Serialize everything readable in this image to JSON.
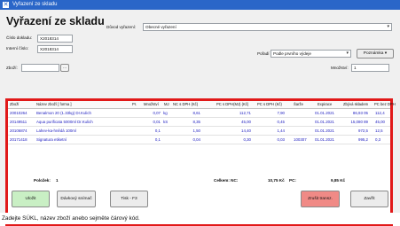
{
  "window": {
    "title": "Vyřazení ze skladu"
  },
  "header": {
    "title": "Vyřazení ze skladu",
    "doc_number_label": "Číslo dokladu:",
    "doc_number_value": "X2018314",
    "internal_number_label": "Interní číslo:",
    "internal_number_value": "X2018314",
    "reason_label": "Důvod vyřazení:",
    "reason_value": "Obecné vyřazení",
    "order_label": "Pořadí",
    "order_value": "Podle prvního výdeje",
    "notes_button": "Poznámka",
    "goods_label": "Zboží:",
    "goods_value": "",
    "goods_ellipsis": "...",
    "quantity_label": "Množství:",
    "quantity_value": "1"
  },
  "table": {
    "columns": [
      "Zboží",
      "Název zboží [ forma ]",
      "Pr.",
      "Množství",
      "MJ",
      "NC s DPH (Kč)",
      "PC s DPH(MJ) (Kč)",
      "PC s DPH (Kč)",
      "Šarže",
      "Expirace",
      "Zbývá skladem",
      "PC bez DPH"
    ],
    "rows": [
      [
        "20010264",
        "Benalmon 20 (1.33kg) Dr.Kulich",
        "",
        "0,07",
        "kg",
        "8,61",
        "112,71",
        "7,90",
        "",
        "01.01.2021",
        "86,93 05",
        "112,4"
      ],
      [
        "20149511",
        "Aqua purificata 5000ml Dr.Kulich",
        "",
        "0,01",
        "kS",
        "8,35",
        "45,00",
        "0,45",
        "",
        "01.01.2021",
        "15,080 89",
        "45,00"
      ],
      [
        "20106874",
        "Lahev-ka-hnědá 100ml",
        "",
        "0,1",
        "",
        "1,50",
        "14,40",
        "1,44",
        "",
        "01.01.2021",
        "972,5",
        "12,5"
      ],
      [
        "20171418",
        "Signatura etiketní",
        "",
        "0,1",
        "",
        "0,04",
        "0,30",
        "0,03",
        "100307",
        "01.01.2021",
        "995,2",
        "0,3"
      ]
    ]
  },
  "footer": {
    "items_label": "Položek:",
    "items_value": "1",
    "total_label": "Celkem: NC:",
    "total_nc": "10,75 Kč",
    "pc_label": "PC:",
    "total_pc": "9,85 Kč",
    "save_button": "Uložit",
    "scanner_button": "Dávkový snímač",
    "print_button": "Tisk - F3",
    "cancel_button": "Zrušit transz.",
    "close_button": "Zavřít"
  },
  "status_bar": {
    "text": "Zadejte SÚKL, název zboží anebo sejměte čárový kód."
  },
  "colors": {
    "titlebar": "#2a66c8",
    "highlight_border": "#e11919",
    "row_text": "#1d1dc0",
    "save_button": "#c9efc4",
    "cancel_button": "#f08a86"
  }
}
